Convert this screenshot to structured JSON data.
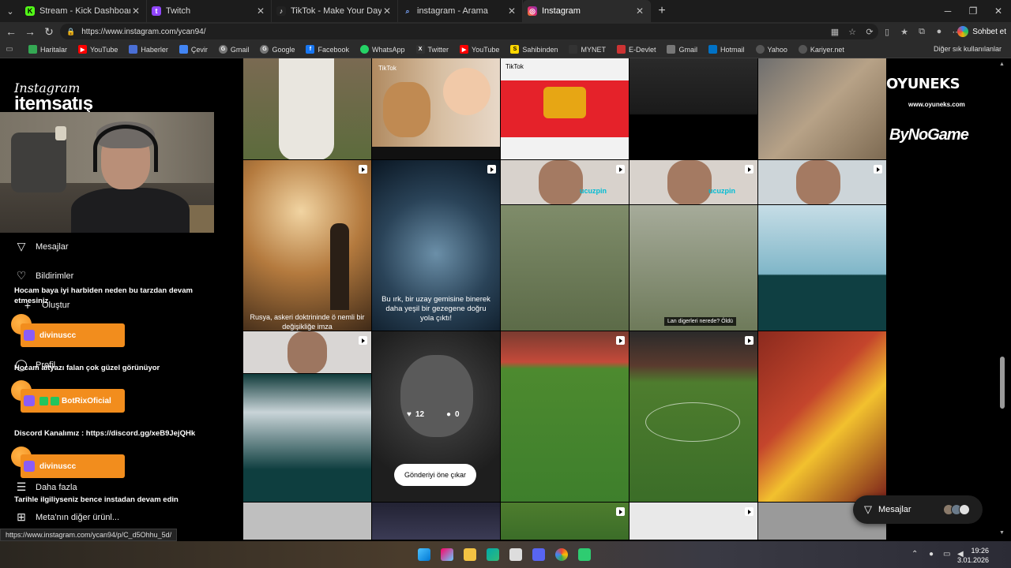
{
  "browser": {
    "tabs": [
      {
        "label": "Stream - Kick Dashboard",
        "fav_color": "#53fc18",
        "fav_glyph": "K"
      },
      {
        "label": "Twitch",
        "fav_color": "#9146ff",
        "fav_glyph": "t"
      },
      {
        "label": "TikTok - Make Your Day",
        "fav_color": "#ffffff",
        "fav_glyph": "♪"
      },
      {
        "label": "instagram - Arama",
        "fav_color": "#7aa7ff",
        "fav_glyph": "⌕"
      },
      {
        "label": "Instagram",
        "fav_color": "#e1306c",
        "fav_glyph": "◎"
      }
    ],
    "new_tab": "+",
    "url": "https://www.instagram.com/ycan94/",
    "chat_label": "Sohbet et",
    "bookmarks": [
      {
        "label": "Haritalar",
        "color": "#34a853"
      },
      {
        "label": "YouTube",
        "color": "#ff0000"
      },
      {
        "label": "Haberler",
        "color": "#4a6fd6"
      },
      {
        "label": "Çevir",
        "color": "#4285f4"
      },
      {
        "label": "Gmail",
        "color": "#888888"
      },
      {
        "label": "Google",
        "color": "#888888"
      },
      {
        "label": "Facebook",
        "color": "#1877f2"
      },
      {
        "label": "WhatsApp",
        "color": "#25d366"
      },
      {
        "label": "Twitter",
        "color": "#333333"
      },
      {
        "label": "YouTube",
        "color": "#ff0000"
      },
      {
        "label": "Sahibinden",
        "color": "#ffd700"
      },
      {
        "label": "MYNET",
        "color": "#333333"
      },
      {
        "label": "E-Devlet",
        "color": "#c33"
      },
      {
        "label": "Gmail",
        "color": "#888888"
      },
      {
        "label": "Hotmail",
        "color": "#0072c6"
      },
      {
        "label": "Yahoo",
        "color": "#555555"
      },
      {
        "label": "Kariyer.net",
        "color": "#555555"
      }
    ],
    "other_bookmarks": "Diğer sık kullanılanlar",
    "status_url": "https://www.instagram.com/ycan94/p/C_d5Ohhu_5d/"
  },
  "overlay": {
    "logo_top": "Instagram",
    "logo_bottom": "itemsatış",
    "sponsor1": "OYUNEKS",
    "sponsor1_sub": "www.oyuneks.com",
    "sponsor2": "ByNoGame",
    "chat": [
      {
        "text": "Hocam baya iyi harbiden neden bu tarzdan devam etmesiniz"
      },
      {
        "user": "divinuscc"
      },
      {
        "text": "Hocam altyazı falan çok güzel görünüyor"
      },
      {
        "user": "BotRixOficial"
      },
      {
        "text": "Discord Kanalımız : https://discord.gg/xeB9JejQHk"
      },
      {
        "user": "divinuscc"
      },
      {
        "text": "Tarihle ilgiliyseniz bence instadan devam edin"
      }
    ]
  },
  "sidebar": {
    "items": [
      {
        "label": "Mesajlar",
        "icon": "send-icon"
      },
      {
        "label": "Bildirimler",
        "icon": "heart-icon"
      },
      {
        "label": "Oluştur",
        "icon": "plus-icon"
      },
      {
        "label": "Profil",
        "icon": "profile-icon"
      },
      {
        "label": "Daha fazla",
        "icon": "menu-icon"
      },
      {
        "label": "Meta'nın diğer ürünl...",
        "icon": "meta-icon"
      }
    ]
  },
  "grid": {
    "captions": {
      "rusya": "Rusya, askeri doktrininde ö nemli bir değişikliğe imza",
      "uzay": "Bu ırk, bir uzay gemisine binerek daha yeşil bir gezegene doğru yola çıktı!",
      "lan": "Lan digerleri nerede? Öldü",
      "tiktok": "TikTok",
      "ucuzpin": "ucuzpin"
    },
    "likes": "12",
    "comments": "0",
    "pin_button": "Gönderiyi öne çıkar"
  },
  "messages_pill": {
    "label": "Mesajlar"
  },
  "taskbar": {
    "time": "19:26",
    "date": "3.01.2026"
  }
}
